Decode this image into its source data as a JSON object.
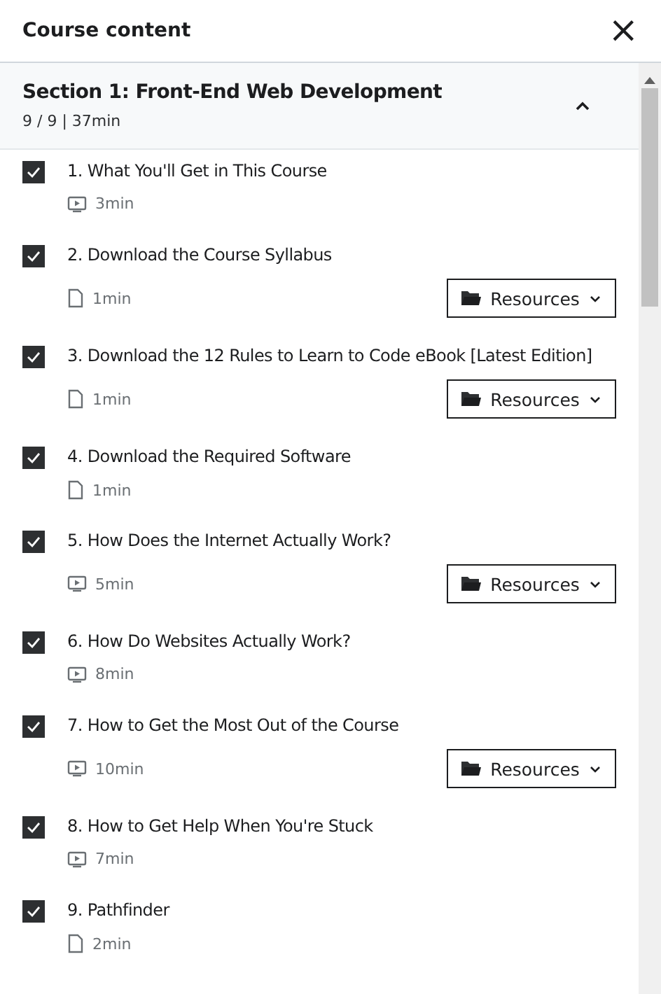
{
  "header": {
    "title": "Course content",
    "close": "×"
  },
  "section": {
    "title": "Section 1: Front-End Web Development",
    "summary": "9 / 9 | 37min",
    "expanded": true
  },
  "lectures": [
    {
      "title": "1. What You'll Get in This Course",
      "checked": true,
      "kind": "video",
      "duration": "3min"
    },
    {
      "title": "2. Download the Course Syllabus",
      "checked": true,
      "kind": "article",
      "duration": "1min",
      "resources": "Resources"
    },
    {
      "title": "3. Download the 12 Rules to Learn to Code eBook [Latest Edition]",
      "checked": true,
      "kind": "article",
      "duration": "1min",
      "resources": "Resources"
    },
    {
      "title": "4. Download the Required Software",
      "checked": true,
      "kind": "article",
      "duration": "1min"
    },
    {
      "title": "5. How Does the Internet Actually Work?",
      "checked": true,
      "kind": "video",
      "duration": "5min",
      "resources": "Resources"
    },
    {
      "title": "6. How Do Websites Actually Work?",
      "checked": true,
      "kind": "video",
      "duration": "8min"
    },
    {
      "title": "7. How to Get the Most Out of the Course",
      "checked": true,
      "kind": "video",
      "duration": "10min",
      "resources": "Resources"
    },
    {
      "title": "8. How to Get Help When You're Stuck",
      "checked": true,
      "kind": "video",
      "duration": "7min"
    },
    {
      "title": "9. Pathfinder",
      "checked": true,
      "kind": "article",
      "duration": "2min"
    }
  ]
}
